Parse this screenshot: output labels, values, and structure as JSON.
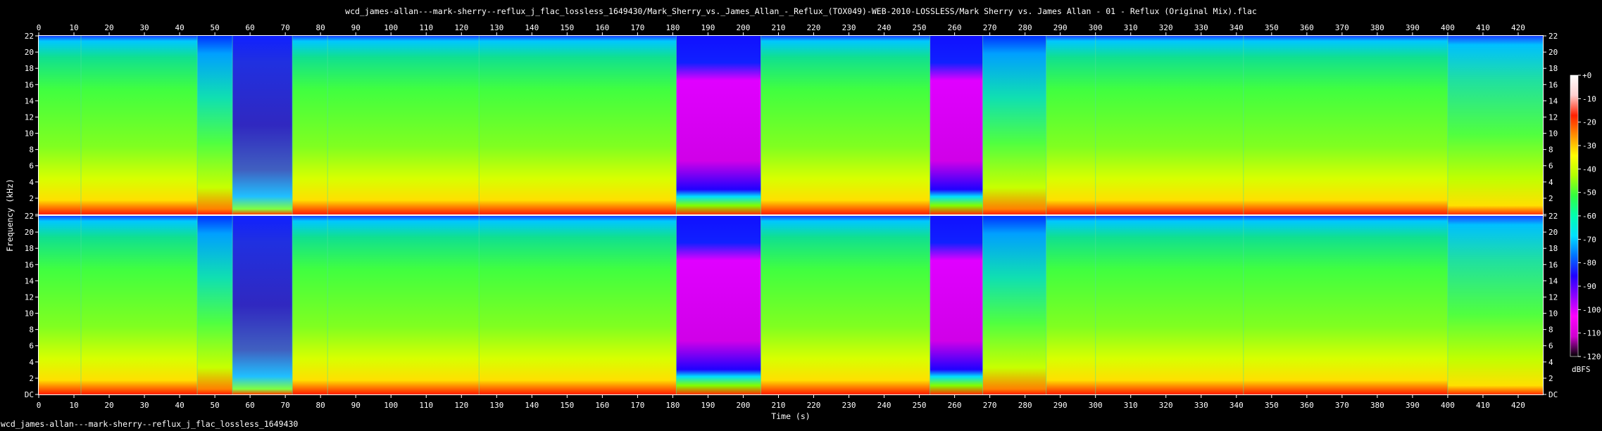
{
  "title": "wcd_james-allan---mark-sherry--reflux_j_flac_lossless_1649430/Mark_Sherry_vs._James_Allan_-_Reflux_(TOX049)-WEB-2010-LOSSLESS/Mark Sherry vs. James Allan - 01 - Reflux (Original Mix).flac",
  "footer": "wcd_james-allan---mark-sherry--reflux_j_flac_lossless_1649430",
  "chart_data": {
    "type": "heatmap",
    "channels": 2,
    "xlabel": "Time (s)",
    "ylabel": "Frequency (kHz)",
    "xlim": [
      0,
      427
    ],
    "ylim": [
      0,
      22
    ],
    "x_ticks": [
      0,
      10,
      20,
      30,
      40,
      50,
      60,
      70,
      80,
      90,
      100,
      110,
      120,
      130,
      140,
      150,
      160,
      170,
      180,
      190,
      200,
      210,
      220,
      230,
      240,
      250,
      260,
      270,
      280,
      290,
      300,
      310,
      320,
      330,
      340,
      350,
      360,
      370,
      380,
      390,
      400,
      410,
      420
    ],
    "y_ticks": [
      {
        "v": 22,
        "label": "22"
      },
      {
        "v": 20,
        "label": "20"
      },
      {
        "v": 18,
        "label": "18"
      },
      {
        "v": 16,
        "label": "16"
      },
      {
        "v": 14,
        "label": "14"
      },
      {
        "v": 12,
        "label": "12"
      },
      {
        "v": 10,
        "label": "10"
      },
      {
        "v": 8,
        "label": "8"
      },
      {
        "v": 6,
        "label": "6"
      },
      {
        "v": 4,
        "label": "4"
      },
      {
        "v": 2,
        "label": "2"
      },
      {
        "v": 0,
        "label": "DC"
      }
    ],
    "colorbar": {
      "label": "dBFS",
      "range": [
        -120,
        0
      ],
      "ticks": [
        "+0",
        "-10",
        "-20",
        "-30",
        "-40",
        "-50",
        "-60",
        "-70",
        "-80",
        "-90",
        "-100",
        "-110",
        "-120"
      ],
      "stops": [
        "#ffffff",
        "#ffd0d0",
        "#ff2000",
        "#ff9000",
        "#ffff00",
        "#b0ff00",
        "#30ff40",
        "#00ffb0",
        "#00e0ff",
        "#0070ff",
        "#2000ff",
        "#9000ff",
        "#ff00ff",
        "#d000d0",
        "#000000"
      ]
    },
    "segments": [
      {
        "start": 0,
        "end": 12,
        "level": "green"
      },
      {
        "start": 12,
        "end": 45,
        "level": "green"
      },
      {
        "start": 45,
        "end": 55,
        "level": "buildup"
      },
      {
        "start": 55,
        "end": 72,
        "level": "quiet"
      },
      {
        "start": 72,
        "end": 82,
        "level": "green"
      },
      {
        "start": 82,
        "end": 125,
        "level": "green"
      },
      {
        "start": 125,
        "end": 181,
        "level": "green"
      },
      {
        "start": 181,
        "end": 205,
        "level": "breakdown"
      },
      {
        "start": 205,
        "end": 253,
        "level": "green"
      },
      {
        "start": 253,
        "end": 268,
        "level": "breakdown"
      },
      {
        "start": 268,
        "end": 286,
        "level": "buildup"
      },
      {
        "start": 286,
        "end": 300,
        "level": "green"
      },
      {
        "start": 300,
        "end": 342,
        "level": "green"
      },
      {
        "start": 342,
        "end": 400,
        "level": "green"
      },
      {
        "start": 400,
        "end": 427,
        "level": "fade"
      }
    ]
  }
}
